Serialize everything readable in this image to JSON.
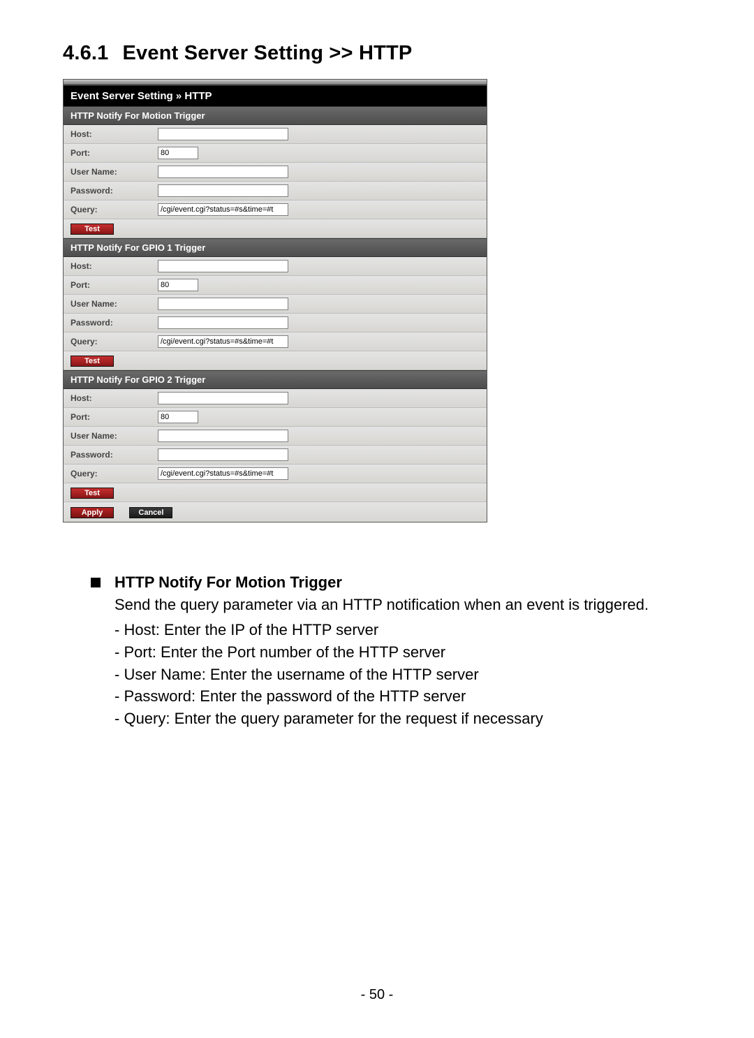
{
  "section": {
    "number": "4.6.1",
    "title": "Event Server Setting >> HTTP"
  },
  "panel": {
    "header": "Event Server Setting » HTTP",
    "groups": [
      {
        "title": "HTTP Notify For Motion Trigger",
        "host_label": "Host:",
        "host_value": "",
        "port_label": "Port:",
        "port_value": "80",
        "user_label": "User Name:",
        "user_value": "",
        "pass_label": "Password:",
        "pass_value": "",
        "query_label": "Query:",
        "query_value": "/cgi/event.cgi?status=#s&time=#t",
        "test_label": "Test"
      },
      {
        "title": "HTTP Notify For GPIO 1 Trigger",
        "host_label": "Host:",
        "host_value": "",
        "port_label": "Port:",
        "port_value": "80",
        "user_label": "User Name:",
        "user_value": "",
        "pass_label": "Password:",
        "pass_value": "",
        "query_label": "Query:",
        "query_value": "/cgi/event.cgi?status=#s&time=#t",
        "test_label": "Test"
      },
      {
        "title": "HTTP Notify For GPIO 2 Trigger",
        "host_label": "Host:",
        "host_value": "",
        "port_label": "Port:",
        "port_value": "80",
        "user_label": "User Name:",
        "user_value": "",
        "pass_label": "Password:",
        "pass_value": "",
        "query_label": "Query:",
        "query_value": "/cgi/event.cgi?status=#s&time=#t",
        "test_label": "Test"
      }
    ],
    "apply_label": "Apply",
    "cancel_label": "Cancel"
  },
  "description": {
    "heading": "HTTP Notify For Motion Trigger",
    "intro": "Send the query parameter via an HTTP notification when an event is triggered.",
    "items": [
      "Host: Enter the IP of the HTTP server",
      "Port: Enter the Port number of the HTTP server",
      "User Name: Enter the username of the HTTP server",
      "Password: Enter the password of the HTTP server",
      "Query: Enter the query parameter for the request if necessary"
    ]
  },
  "page_number": "- 50 -"
}
